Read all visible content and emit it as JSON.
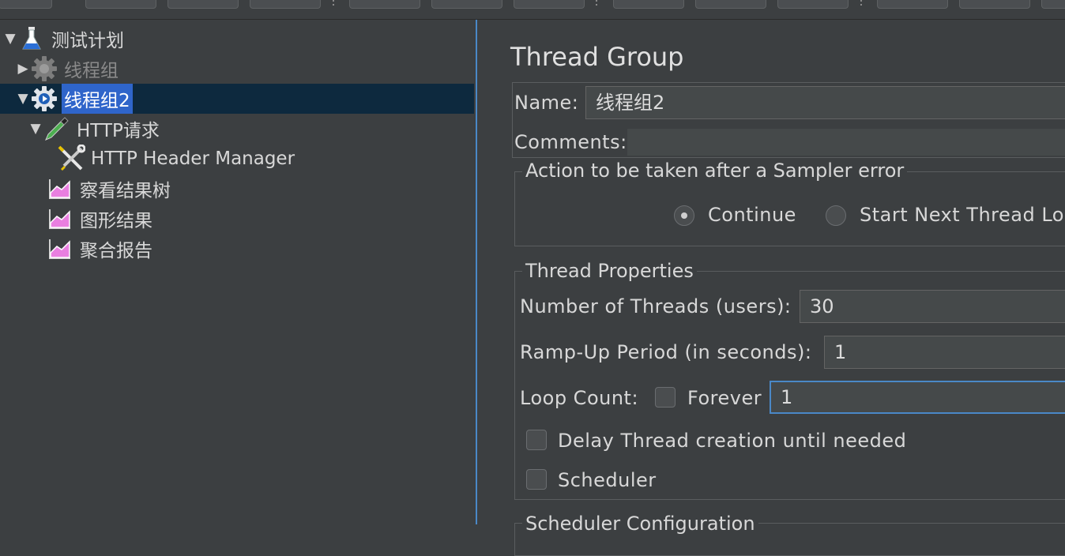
{
  "tree": {
    "items": [
      {
        "label": "测试计划",
        "icon": "flask-icon",
        "expanded": true
      },
      {
        "label": "线程组",
        "icon": "gear-icon",
        "expanded": false,
        "disabled": true
      },
      {
        "label": "线程组2",
        "icon": "gear-icon",
        "expanded": true,
        "selected": true
      },
      {
        "label": "HTTP请求",
        "icon": "pipette-icon",
        "expanded": true
      },
      {
        "label": "HTTP Header Manager",
        "icon": "wrench-screwdriver-icon"
      },
      {
        "label": "察看结果树",
        "icon": "chart-listener-icon"
      },
      {
        "label": "图形结果",
        "icon": "chart-listener-icon"
      },
      {
        "label": "聚合报告",
        "icon": "chart-listener-icon"
      }
    ]
  },
  "form": {
    "title": "Thread Group",
    "name_label": "Name:",
    "name_value": "线程组2",
    "comments_label": "Comments:",
    "comments_value": "",
    "sampler_error": {
      "legend": "Action to be taken after a Sampler error",
      "options": [
        {
          "label": "Continue",
          "selected": true
        },
        {
          "label": "Start Next Thread Lo",
          "selected": false
        }
      ]
    },
    "thread_props": {
      "legend": "Thread Properties",
      "threads_label": "Number of Threads (users):",
      "threads_value": "30",
      "rampup_label": "Ramp-Up Period (in seconds):",
      "rampup_value": "1",
      "loop_label": "Loop Count:",
      "forever_label": "Forever",
      "forever_checked": false,
      "loop_value": "1",
      "delay_label": "Delay Thread creation until needed",
      "delay_checked": false,
      "scheduler_label": "Scheduler",
      "scheduler_checked": false
    },
    "scheduler_config_legend": "Scheduler Configuration"
  },
  "colors": {
    "background": "#3c3f41",
    "selection": "#2f65ca",
    "focus": "#4a88c7"
  }
}
